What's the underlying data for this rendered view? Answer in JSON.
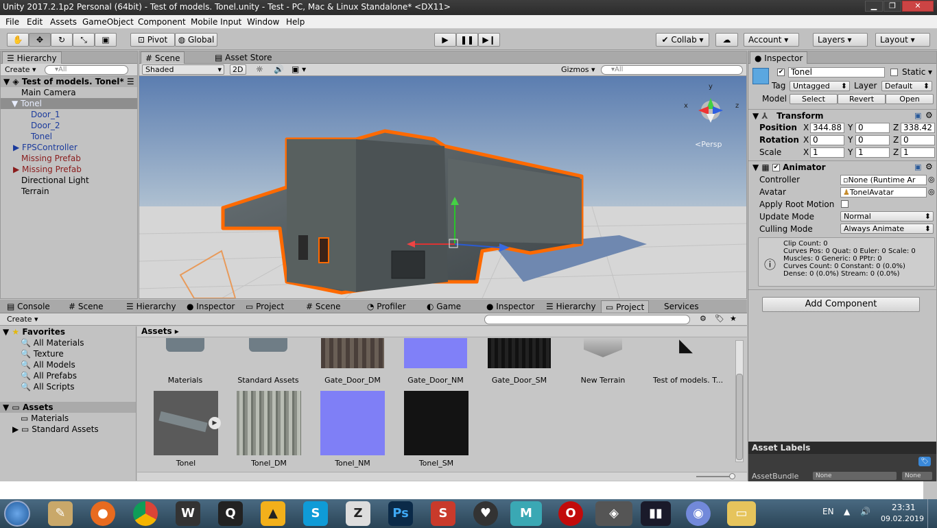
{
  "window": {
    "title": "Unity 2017.2.1p2 Personal (64bit) - Test of models. Tonel.unity - Test - PC, Mac & Linux Standalone* <DX11>",
    "minimize": "▁",
    "maximize": "❐",
    "close": "✕"
  },
  "menu": [
    "File",
    "Edit",
    "Assets",
    "GameObject",
    "Component",
    "Mobile Input",
    "Window",
    "Help"
  ],
  "toolbar": {
    "pivot": "Pivot",
    "global": "Global",
    "collab": "Collab ▾",
    "account": "Account",
    "layers": "Layers",
    "layout": "Layout"
  },
  "hierarchy": {
    "tab": "Hierarchy",
    "create": "Create ▾",
    "search": "▾All",
    "scene": "Test of models. Tonel*",
    "items": [
      {
        "label": "Main Camera"
      },
      {
        "label": "Tonel"
      },
      {
        "label": "Door_1"
      },
      {
        "label": "Door_2"
      },
      {
        "label": "Tonel"
      },
      {
        "label": "FPSController"
      },
      {
        "label": "Missing Prefab"
      },
      {
        "label": "Missing Prefab"
      },
      {
        "label": "Directional Light"
      },
      {
        "label": "Terrain"
      }
    ]
  },
  "scene": {
    "tab": "Scene",
    "tab2": "Asset Store",
    "shading": "Shaded",
    "mode2d": "2D",
    "gizmos": "Gizmos ▾",
    "search": "▾All",
    "persp": "<Persp",
    "axis_x": "x",
    "axis_z": "z",
    "axis_y": "y"
  },
  "bottom_tabs": [
    "Console",
    "Scene",
    "Hierarchy",
    "Inspector",
    "Project",
    "Scene",
    "Profiler",
    "Game",
    "Inspector",
    "Hierarchy",
    "Project",
    "Services"
  ],
  "project": {
    "create": "Create ▾",
    "favorites_title": "Favorites",
    "favorites": [
      "All Materials",
      "Texture",
      "All Models",
      "All Prefabs",
      "All Scripts"
    ],
    "assets_title": "Assets",
    "folders": [
      "Materials",
      "Standard Assets"
    ],
    "breadcrumb": "Assets",
    "row1": [
      "Materials",
      "Standard Assets",
      "Gate_Door_DM",
      "Gate_Door_NM",
      "Gate_Door_SM",
      "New Terrain",
      "Test of models. T..."
    ],
    "row2": [
      "Tonel",
      "Tonel_DM",
      "Tonel_NM",
      "Tonel_SM"
    ]
  },
  "inspector": {
    "tab": "Inspector",
    "name": "Tonel",
    "static": "Static",
    "tag_label": "Tag",
    "tag": "Untagged",
    "layer_label": "Layer",
    "layer": "Default",
    "model_label": "Model",
    "select": "Select",
    "revert": "Revert",
    "open": "Open",
    "transform": {
      "title": "Transform",
      "position": "Position",
      "rotation": "Rotation",
      "scale": "Scale",
      "x": "X",
      "y": "Y",
      "z": "Z",
      "pos": [
        "344.88",
        "0",
        "338.42"
      ],
      "rot": [
        "0",
        "0",
        "0"
      ],
      "scl": [
        "1",
        "1",
        "1"
      ]
    },
    "animator": {
      "title": "Animator",
      "controller_label": "Controller",
      "controller": "None (Runtime Ar",
      "avatar_label": "Avatar",
      "avatar": "TonelAvatar",
      "root_label": "Apply Root Motion",
      "update_label": "Update Mode",
      "update": "Normal",
      "culling_label": "Culling Mode",
      "culling": "Always Animate",
      "info": [
        "Clip Count: 0",
        "Curves Pos: 0 Quat: 0 Euler: 0 Scale: 0",
        "Muscles: 0 Generic: 0 PPtr: 0",
        "Curves Count: 0 Constant: 0 (0.0%)",
        "Dense: 0 (0.0%) Stream: 0 (0.0%)"
      ]
    },
    "add_component": "Add Component",
    "asset_labels": "Asset Labels",
    "assetbundle_label": "AssetBundle",
    "assetbundle": "None",
    "assetbundle2": "None"
  },
  "taskbar": {
    "lang": "EN",
    "time": "23:31",
    "date": "09.02.2019"
  }
}
